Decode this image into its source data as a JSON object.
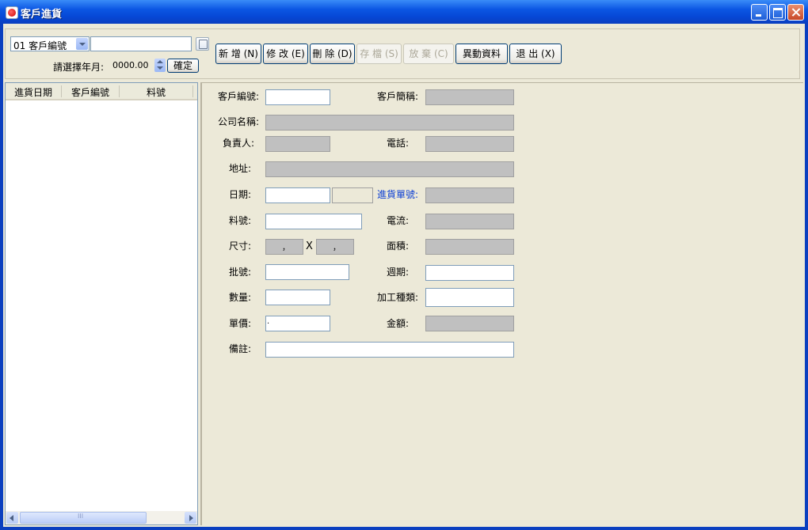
{
  "window": {
    "title": "客戶進貨",
    "controls": [
      "minimize-icon",
      "maximize-icon",
      "close-icon"
    ]
  },
  "toolbar": {
    "field_select": "01 客戶編號",
    "search_value": "",
    "year_month_label": "請選擇年月:",
    "year_month_value": "0000.00",
    "confirm_label": "確定",
    "buttons": {
      "add": "新 增 (N)",
      "edit": "修 改 (E)",
      "delete": "刪 除 (D)",
      "save": "存 檔 (S)",
      "abandon": "放 棄 (C)",
      "changes": "異動資料",
      "exit": "退 出 (X)"
    }
  },
  "list": {
    "columns": [
      "進貨日期",
      "客戶編號",
      "料號"
    ],
    "rows": [],
    "scroll_grip": "III"
  },
  "form": {
    "customer_id_label": "客戶編號:",
    "customer_short_label": "客戶簡稱:",
    "company_label": "公司名稱:",
    "owner_label": "負責人:",
    "phone_label": "電話:",
    "address_label": "地址:",
    "date_label": "日期:",
    "receipt_no_label": "進貨單號:",
    "part_no_label": "料號:",
    "current_label": "電流:",
    "size_label": "尺寸:",
    "size_sep": "X",
    "size_w": "，",
    "size_h": "，",
    "area_label": "面積:",
    "batch_label": "批號:",
    "cycle_label": "週期:",
    "qty_label": "數量:",
    "process_label": "加工種類:",
    "price_label": "單價:",
    "price_value": ".",
    "amount_label": "金額:",
    "remark_label": "備註:"
  }
}
